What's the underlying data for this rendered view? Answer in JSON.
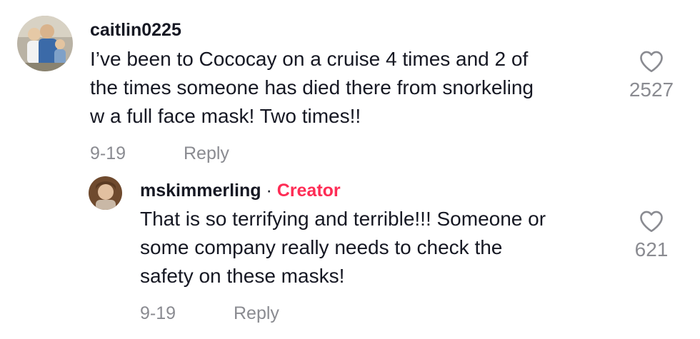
{
  "comment": {
    "username": "caitlin0225",
    "text_lines": [
      "I’ve been to Cococay on a cruise 4 times and 2 of",
      "the times someone has died there from snorkeling",
      "w a full face mask! Two times!!"
    ],
    "date": "9-19",
    "reply_label": "Reply",
    "like_count": "2527",
    "like_icon": "heart-outline-icon"
  },
  "reply": {
    "username": "mskimmerling",
    "separator": " · ",
    "badge": "Creator",
    "text_lines": [
      "That is so terrifying and terrible!!! Someone or",
      "some company really needs to check the",
      "safety on these masks!"
    ],
    "date": "9-19",
    "reply_label": "Reply",
    "like_count": "621",
    "like_icon": "heart-outline-icon"
  },
  "colors": {
    "text": "#161823",
    "muted": "#8a8b91",
    "creator_badge": "#fe2c55"
  }
}
